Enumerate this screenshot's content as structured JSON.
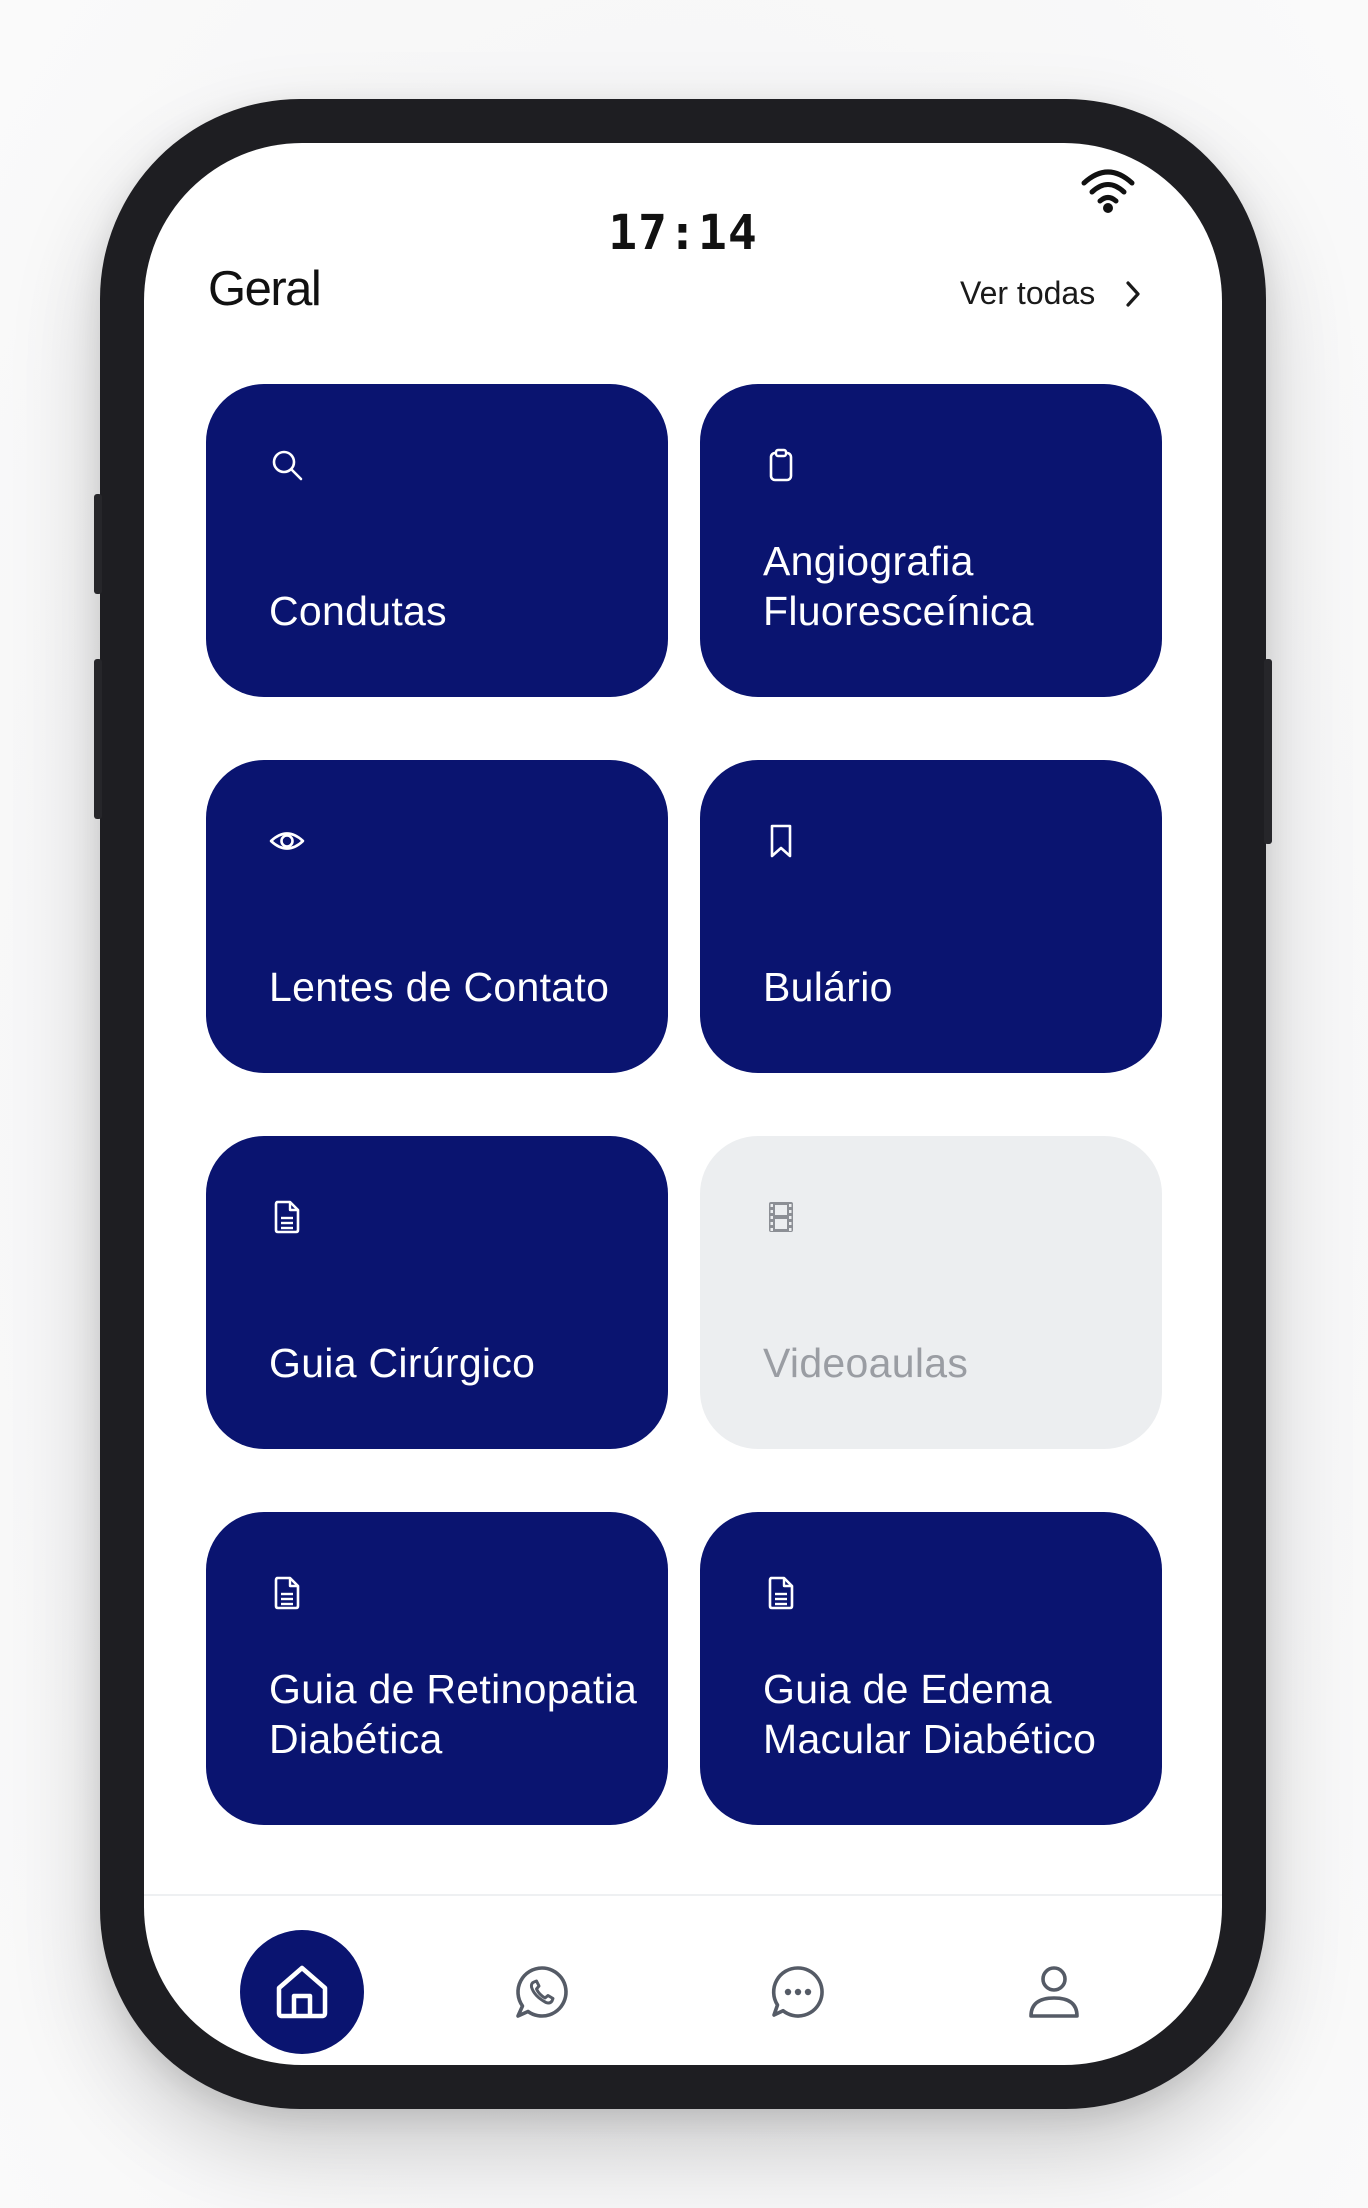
{
  "status_bar": {
    "time": "17:14",
    "wifi_icon": "wifi-icon"
  },
  "section": {
    "title": "Geral",
    "see_all_label": "Ver todas",
    "see_all_icon": "chevron-right-icon"
  },
  "colors": {
    "card_active": "#0A1470",
    "card_disabled": "#ECEEF0",
    "text_disabled": "#9A9DA3",
    "tab_active": "#0A1470"
  },
  "cards": [
    {
      "label": "Condutas",
      "icon": "search-icon",
      "enabled": true
    },
    {
      "label": "Angiografia Fluoresceínica",
      "icon": "clipboard-icon",
      "enabled": true
    },
    {
      "label": "Lentes de Contato",
      "icon": "eye-icon",
      "enabled": true
    },
    {
      "label": "Bulário",
      "icon": "bookmark-icon",
      "enabled": true
    },
    {
      "label": "Guia Cirúrgico",
      "icon": "document-icon",
      "enabled": true
    },
    {
      "label": "Videoaulas",
      "icon": "film-icon",
      "enabled": false
    },
    {
      "label": "Guia de Retinopatia Diabética",
      "icon": "document-icon",
      "enabled": true
    },
    {
      "label": "Guia de Edema Macular Diabético",
      "icon": "document-icon",
      "enabled": true
    }
  ],
  "tab_bar": [
    {
      "icon": "home-icon",
      "active": true
    },
    {
      "icon": "whatsapp-icon",
      "active": false
    },
    {
      "icon": "chat-bubble-icon",
      "active": false
    },
    {
      "icon": "user-icon",
      "active": false
    }
  ]
}
